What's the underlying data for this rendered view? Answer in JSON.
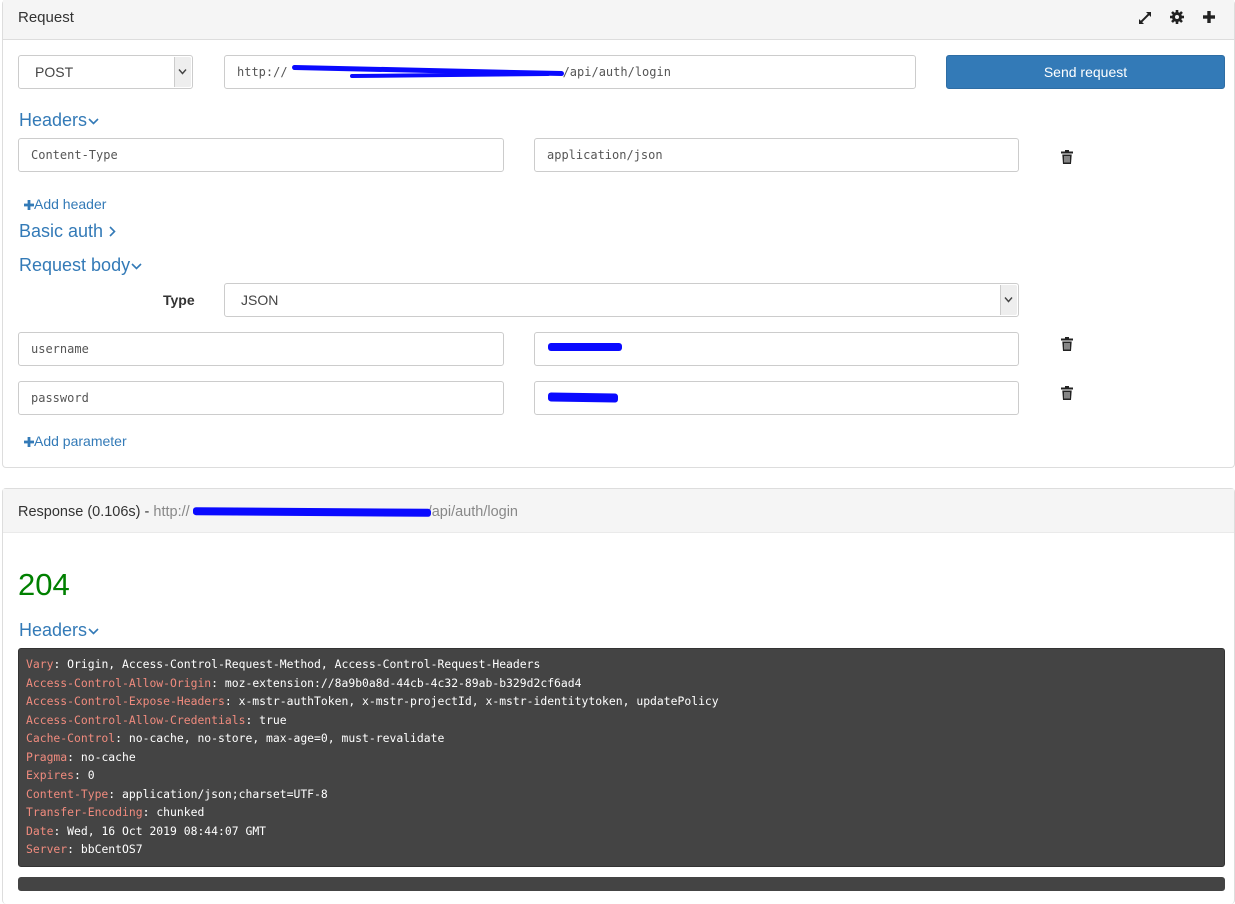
{
  "request_panel": {
    "title": "Request",
    "icons": [
      "expand-icon",
      "gear-icon",
      "plus-icon"
    ],
    "method": "POST",
    "url_scheme": "http://",
    "url_suffix": "/api/auth/login",
    "send_label": "Send request",
    "headers_label": "Headers",
    "headers": [
      {
        "key": "Content-Type",
        "value": "application/json"
      }
    ],
    "add_header_label": "Add header",
    "basic_auth_label": "Basic auth",
    "body_label": "Request body",
    "type_label": "Type",
    "body_type": "JSON",
    "params": [
      {
        "key": "username",
        "value": ""
      },
      {
        "key": "password",
        "value": ""
      }
    ],
    "add_param_label": "Add parameter"
  },
  "response_panel": {
    "title": "Response (0.106s)",
    "separator": " - ",
    "url_scheme": "http://",
    "url_suffix": "/api/auth/login",
    "status": "204",
    "headers_label": "Headers",
    "headers": [
      {
        "key": "Vary",
        "value": "Origin, Access-Control-Request-Method, Access-Control-Request-Headers"
      },
      {
        "key": "Access-Control-Allow-Origin",
        "value": "moz-extension://8a9b0a8d-44cb-4c32-89ab-b329d2cf6ad4"
      },
      {
        "key": "Access-Control-Expose-Headers",
        "value": "x-mstr-authToken, x-mstr-projectId, x-mstr-identitytoken, updatePolicy"
      },
      {
        "key": "Access-Control-Allow-Credentials",
        "value": "true"
      },
      {
        "key": "Cache-Control",
        "value": "no-cache, no-store, max-age=0, must-revalidate"
      },
      {
        "key": "Pragma",
        "value": "no-cache"
      },
      {
        "key": "Expires",
        "value": "0"
      },
      {
        "key": "Content-Type",
        "value": "application/json;charset=UTF-8"
      },
      {
        "key": "Transfer-Encoding",
        "value": "chunked"
      },
      {
        "key": "Date",
        "value": "Wed, 16 Oct 2019 08:44:07 GMT"
      },
      {
        "key": "Server",
        "value": "bbCentOS7"
      }
    ]
  },
  "colors": {
    "link": "#337ab7",
    "primary_button": "#337ab7",
    "status_ok": "#008000",
    "code_background": "#444444",
    "header_key": "#f08b7e",
    "redaction": "#0a0aff"
  }
}
